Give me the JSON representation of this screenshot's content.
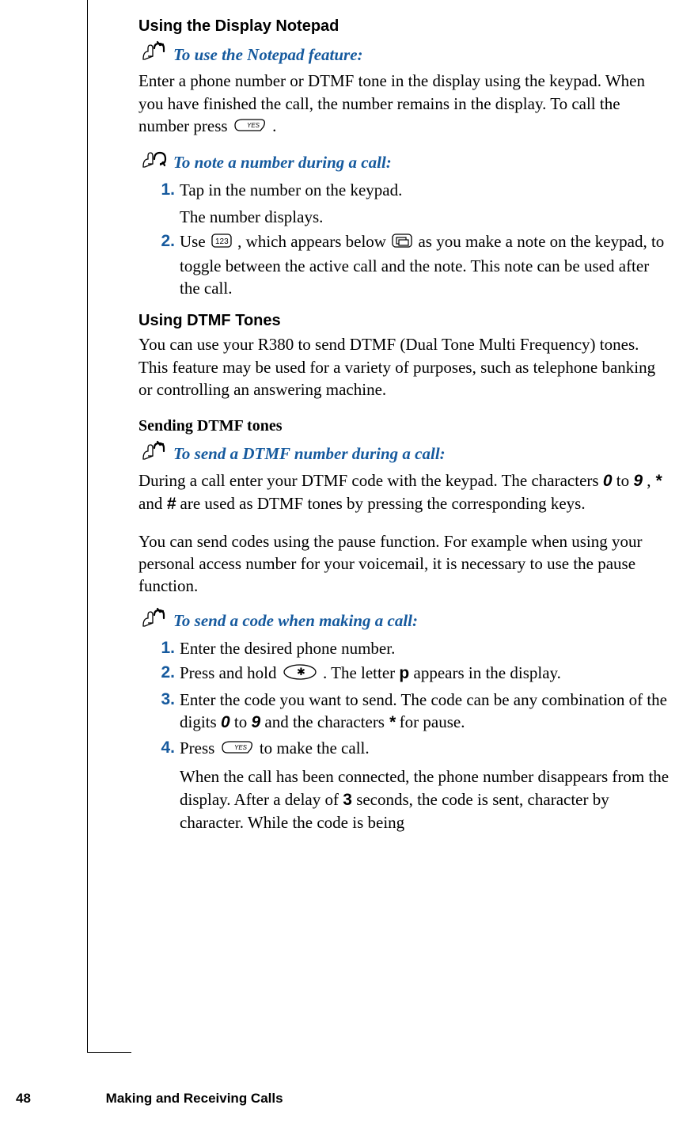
{
  "section1": {
    "heading": "Using the Display Notepad",
    "instr1_title": "To use the Notepad feature:",
    "instr1_body_a": "Enter a phone number or DTMF tone in the display using the keypad. When you have finished the call, the number remains in the display. To call the number press ",
    "instr1_body_b": ".",
    "instr2_title": "To note a number during a call:",
    "step1_num": "1.",
    "step1_a": "Tap in the number on the keypad.",
    "step1_b": "The number displays.",
    "step2_num": "2.",
    "step2_a": "Use ",
    "step2_b": ", which appears below ",
    "step2_c": " as you make a note on the keypad, to toggle between the active call and the note. This note can be used after the call."
  },
  "section2": {
    "heading": "Using DTMF Tones",
    "body": "You can use your R380 to send DTMF (Dual Tone Multi Frequency) tones. This feature may be used for a variety of purposes, such as telephone banking or controlling an answering machine.",
    "sub_heading": "Sending DTMF tones",
    "instr1_title": "To send a DTMF number during a call:",
    "instr1_body_a": "During a call enter your DTMF code with the keypad. The characters ",
    "k0": "0",
    "instr1_body_b": " to ",
    "k9": "9",
    "instr1_body_c": ", ",
    "kstar": "*",
    "instr1_body_d": " and ",
    "khash": "#",
    "instr1_body_e": " are used as DTMF tones by pressing the corresponding keys.",
    "pause_body": "You can send codes using the pause function. For example when using your personal access number for your voicemail, it is necessary to use the pause function.",
    "instr2_title": "To send a code when making a call:",
    "s1_num": "1.",
    "s1": "Enter the desired phone number.",
    "s2_num": "2.",
    "s2_a": "Press and hold ",
    "s2_b": ". The letter ",
    "s2_p": "p",
    "s2_c": " appears in the display.",
    "s3_num": "3.",
    "s3_a": "Enter the code you want to send. The code can be any combination of the digits ",
    "s3_b": " to ",
    "s3_c": " and the characters ",
    "s3_d": " for pause.",
    "s4_num": "4.",
    "s4_a": "Press ",
    "s4_b": " to make the call.",
    "s4_sub_a": "When the call has been connected, the phone number disappears from the display. After a delay of ",
    "s4_3": "3",
    "s4_sub_b": " seconds, the code is sent, character by character. While the code is being"
  },
  "footer": {
    "page": "48",
    "chapter": "Making and Receiving Calls"
  }
}
